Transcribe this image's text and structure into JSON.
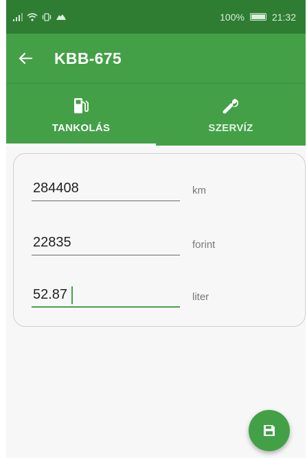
{
  "status_bar": {
    "battery": "100%",
    "time": "21:32"
  },
  "app_bar": {
    "title": "KBB-675"
  },
  "tabs": [
    {
      "label": "TANKOLÁS",
      "icon": "fuel-pump-icon",
      "active": true
    },
    {
      "label": "SZERVÍZ",
      "icon": "wrench-icon",
      "active": false
    }
  ],
  "form": {
    "fields": [
      {
        "value": "284408",
        "unit": "km"
      },
      {
        "value": "22835",
        "unit": "forint"
      },
      {
        "value": "52.87",
        "unit": "liter"
      }
    ]
  },
  "fab": {
    "icon": "save-icon"
  },
  "colors": {
    "primary": "#43a047",
    "primary_dark": "#2e7d32",
    "background": "#f7f7f7"
  }
}
